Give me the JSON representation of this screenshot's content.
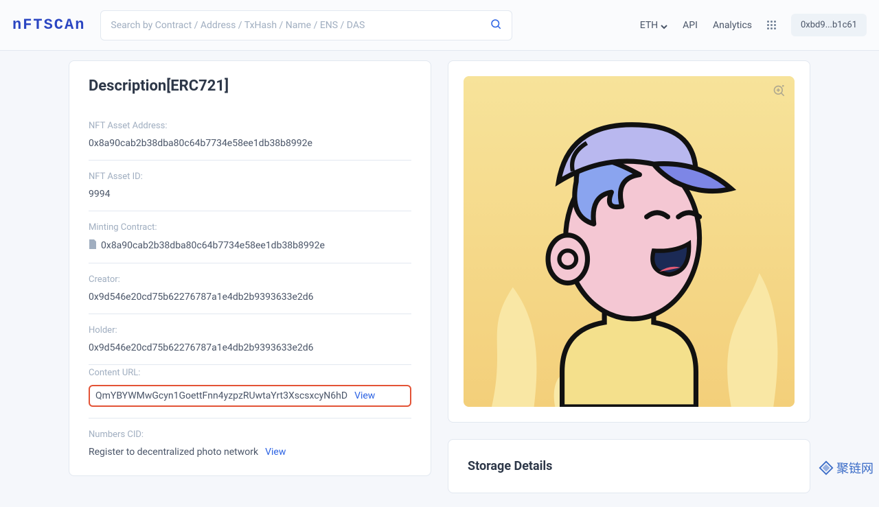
{
  "header": {
    "logo": "nFTSCAn",
    "search_placeholder": "Search by Contract / Address / TxHash / Name / ENS / DAS",
    "chain_label": "ETH",
    "api_label": "API",
    "analytics_label": "Analytics",
    "wallet_short": "0xbd9...b1c61"
  },
  "desc": {
    "title": "Description[ERC721]",
    "fields": {
      "nft_asset_address_label": "NFT Asset Address:",
      "nft_asset_address_value": "0x8a90cab2b38dba80c64b7734e58ee1db38b8992e",
      "nft_asset_id_label": "NFT Asset ID:",
      "nft_asset_id_value": "9994",
      "minting_contract_label": "Minting Contract:",
      "minting_contract_value": "0x8a90cab2b38dba80c64b7734e58ee1db38b8992e",
      "creator_label": "Creator:",
      "creator_value": "0x9d546e20cd75b62276787a1e4db2b9393633e2d6",
      "holder_label": "Holder:",
      "holder_value": "0x9d546e20cd75b62276787a1e4db2b9393633e2d6",
      "content_url_label": "Content URL:",
      "content_url_value": "QmYBYWMwGcyn1GoettFnn4yzpzRUwtaYrt3XscsxcyN6hD",
      "numbers_cid_label": "Numbers CID:",
      "numbers_cid_value": "Register to decentralized photo network",
      "view_label": "View"
    }
  },
  "storage": {
    "title": "Storage Details"
  },
  "watermark": "聚链网"
}
